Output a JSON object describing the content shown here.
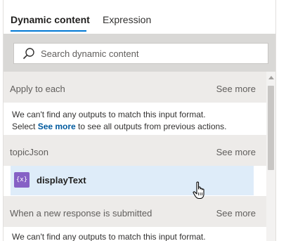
{
  "tabs": [
    {
      "label": "Dynamic content",
      "active": true
    },
    {
      "label": "Expression",
      "active": false
    }
  ],
  "search": {
    "placeholder": "Search dynamic content",
    "value": ""
  },
  "sections": [
    {
      "title": "Apply to each",
      "see_more_label": "See more",
      "message_part1": "We can't find any outputs to match this input format.",
      "message_select": "Select ",
      "message_link": "See more",
      "message_part2": " to see all outputs from previous actions."
    },
    {
      "title": "topicJson",
      "see_more_label": "See more",
      "items": [
        {
          "label": "displayText",
          "icon": "expression-icon",
          "icon_glyph": "{x}"
        }
      ]
    },
    {
      "title": "When a new response is submitted",
      "see_more_label": "See more",
      "message_part1": "We can't find any outputs to match this input format."
    }
  ],
  "colors": {
    "accent": "#0078d4",
    "item_icon": "#8661c5",
    "hover_row": "#deecf9"
  }
}
